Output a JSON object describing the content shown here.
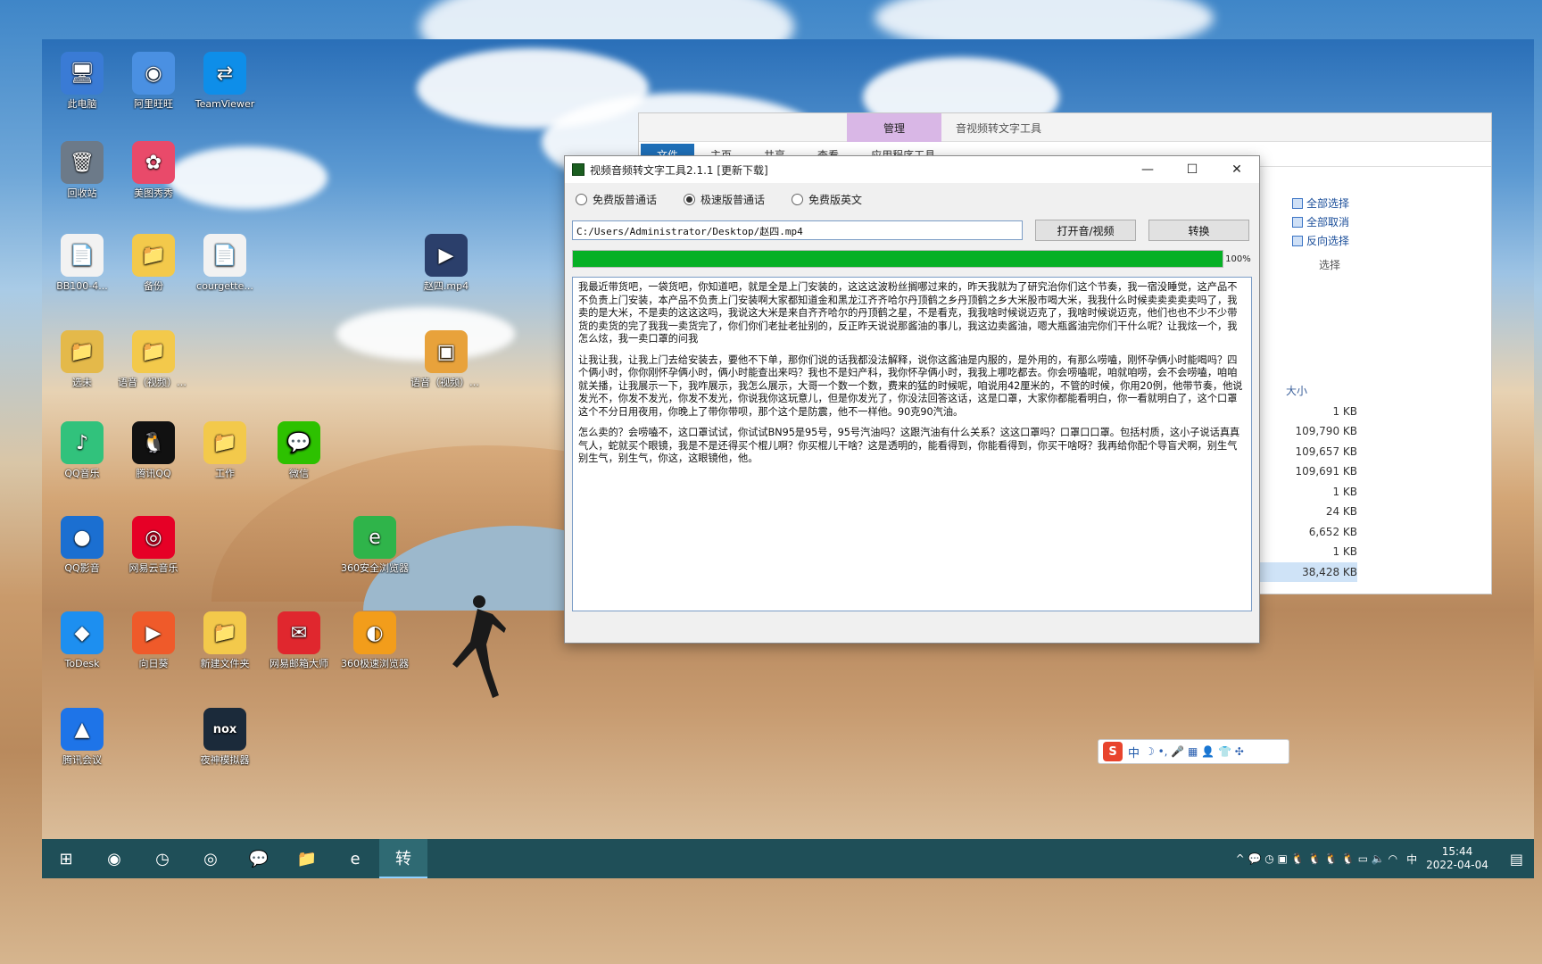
{
  "desktop": {
    "icons": [
      {
        "label": "此电脑",
        "glyph": "🖥",
        "bg": "#3a7bd5"
      },
      {
        "label": "阿里旺旺",
        "glyph": "◉",
        "bg": "#4a90e2"
      },
      {
        "label": "TeamViewer",
        "glyph": "⇄",
        "bg": "#0e8ee9"
      },
      {
        "label": "回收站",
        "glyph": "🗑",
        "bg": "#6c7a89"
      },
      {
        "label": "美图秀秀",
        "glyph": "✿",
        "bg": "#e94a6a"
      },
      {
        "label": "BB100-4...",
        "glyph": "📄",
        "bg": "#f2f2f2"
      },
      {
        "label": "备份",
        "glyph": "📁",
        "bg": "#f3c94b"
      },
      {
        "label": "courgette...",
        "glyph": "📄",
        "bg": "#f2f2f2"
      },
      {
        "label": "赵四.mp4",
        "glyph": "▶",
        "bg": "#2b3f6b"
      },
      {
        "label": "选未",
        "glyph": "📁",
        "bg": "#e4b94a"
      },
      {
        "label": "语音（视频）转文字软件",
        "glyph": "📁",
        "bg": "#f3c94b"
      },
      {
        "label": "语音（视频）转文字软件...",
        "glyph": "▣",
        "bg": "#e8a23b"
      },
      {
        "label": "QQ音乐",
        "glyph": "♪",
        "bg": "#31c27c"
      },
      {
        "label": "腾讯QQ",
        "glyph": "🐧",
        "bg": "#111111"
      },
      {
        "label": "工作",
        "glyph": "📁",
        "bg": "#f3c94b"
      },
      {
        "label": "微信",
        "glyph": "💬",
        "bg": "#2dc100"
      },
      {
        "label": "QQ影音",
        "glyph": "●",
        "bg": "#1b6fd1"
      },
      {
        "label": "网易云音乐",
        "glyph": "◎",
        "bg": "#e60026"
      },
      {
        "label": "360安全浏览器",
        "glyph": "e",
        "bg": "#2fb44a"
      },
      {
        "label": "ToDesk",
        "glyph": "◆",
        "bg": "#1d8ff0"
      },
      {
        "label": "向日葵",
        "glyph": "▶",
        "bg": "#ef5a2a"
      },
      {
        "label": "新建文件夹",
        "glyph": "📁",
        "bg": "#f3c94b"
      },
      {
        "label": "网易邮箱大师",
        "glyph": "✉",
        "bg": "#e0272e"
      },
      {
        "label": "360极速浏览器",
        "glyph": "◐",
        "bg": "#f29d1b"
      },
      {
        "label": "腾讯会议",
        "glyph": "▲",
        "bg": "#1e74e8"
      },
      {
        "label": "夜神模拟器",
        "glyph": "nox",
        "bg": "#1b2a3a"
      }
    ]
  },
  "explorer": {
    "manage_tab": "管理",
    "tool_title": "音视频转文字工具",
    "tabs": [
      "文件",
      "主页",
      "共享",
      "查看",
      "应用程序工具"
    ],
    "select_items": [
      "全部选择",
      "全部取消",
      "反向选择"
    ],
    "select_group_label": "选择",
    "size_header": "大小",
    "sizes": [
      "1 KB",
      "109,790 KB",
      "109,657 KB",
      "109,691 KB",
      "1 KB",
      "24 KB",
      "6,652 KB",
      "1 KB",
      "38,428 KB"
    ]
  },
  "app": {
    "title": "视频音频转文字工具2.1.1 [更新下载]",
    "window_controls": {
      "minimize": "—",
      "maximize": "☐",
      "close": "✕"
    },
    "modes": [
      {
        "label": "免费版普通话",
        "selected": false
      },
      {
        "label": "极速版普通话",
        "selected": true
      },
      {
        "label": "免费版英文",
        "selected": false
      }
    ],
    "path_value": "C:/Users/Administrator/Desktop/赵四.mp4",
    "open_button": "打开音/视频",
    "convert_button": "转换",
    "progress": 1.0,
    "progress_label": "100%",
    "transcript": [
      "我最近带货吧，一袋货吧，你知道吧，就是全是上门安装的，这这这波粉丝搁哪过来的，昨天我就为了研究治你们这个节奏，我一宿没睡觉，这产品不不负责上门安装，本产品不负责上门安装啊大家都知道金和黑龙江齐齐哈尔丹顶鹤之乡丹顶鹤之乡大米股市喝大米，我我什么时候卖卖卖卖卖吗了，我卖的是大米，不是卖的这这这吗，我说这大米是来自齐齐哈尔的丹顶鹤之星，不是看克，我我啥时候说迈克了，我啥时候说迈克，他们也也不少不少带货的卖货的完了我我一卖货完了，你们你们老扯老扯别的，反正昨天说说那酱油的事儿，我这边卖酱油，嗯大瓶酱油完你们干什么呢？让我炫一个，我怎么炫，我一卖口罩的问我",
      "让我让我，让我上门去给安装去，要他不下单，那你们说的话我都没法解释，说你这酱油是内服的，是外用的，有那么唠嗑，刚怀孕俩小时能喝吗？四个俩小时，你你刚怀孕俩小时，俩小时能查出来吗？我也不是妇产科，我你怀孕俩小时，我我上哪吃都去。你会唠嗑呢，咱就咱唠，会不会唠嗑，咱咱就关播，让我展示一下，我咋展示，我怎么展示，大哥一个数一个数，费来的猛的时候呢，咱说用42厘米的，不管的时候，你用20例，他带节奏，他说发光不，你发不发光，你发不发光，你说我你这玩意儿，但是你发光了，你没法回答这话，这是口罩，大家你都能看明白，你一看就明白了，这个口罩这个不分日用夜用，你晚上了带你带呗，那个这个是防震，他不一样他。90克90汽油。",
      "怎么卖的？会唠嗑不，这口罩试试，你试试BN95是95号，95号汽油吗？这跟汽油有什么关系？这这口罩吗？口罩口口罩。包括村质，这小子说话真真气人，蛇就买个眼镜，我是不是还得买个棍儿啊？你买棍儿干啥？这是透明的，能看得到，你能看得到，你买干啥呀？我再给你配个导盲犬啊，别生气别生气，别生气，你这，这眼镜他，他。"
    ]
  },
  "ime": {
    "badge": "S",
    "mode": "中",
    "extras": "☽ •, 🎤 ▦ 👤 👕 ✣"
  },
  "taskbar": {
    "items": [
      {
        "name": "start",
        "glyph": "⊞"
      },
      {
        "name": "browser",
        "glyph": "◉"
      },
      {
        "name": "clock-app",
        "glyph": "◷"
      },
      {
        "name": "recorder",
        "glyph": "◎"
      },
      {
        "name": "wechat",
        "glyph": "💬"
      },
      {
        "name": "file-explorer",
        "glyph": "📁"
      },
      {
        "name": "360-browser",
        "glyph": "e"
      },
      {
        "name": "transcribe-tool",
        "glyph": "转"
      }
    ],
    "tray_icons": "^ 💬 ◷ ▣ 🐧 🐧 🐧 🐧 ▭ 🔈 ◠",
    "input_lang": "中",
    "time": "15:44",
    "date": "2022-04-04"
  }
}
